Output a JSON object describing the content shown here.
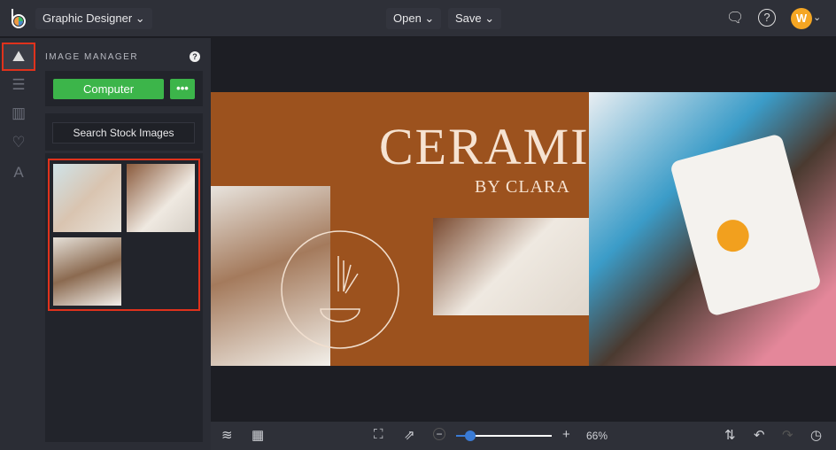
{
  "header": {
    "app_menu": "Graphic Designer",
    "open": "Open",
    "save": "Save",
    "avatar_initial": "W"
  },
  "rail": {
    "items": [
      "image-manager",
      "adjust",
      "layout",
      "favorites",
      "text"
    ]
  },
  "panel": {
    "title": "IMAGE MANAGER",
    "help": "?",
    "computer": "Computer",
    "more": "•••",
    "search_stock": "Search Stock Images",
    "thumbnail_count": 3
  },
  "canvas": {
    "title": "CERAMICS",
    "subtitle": "BY CLARA"
  },
  "bottom": {
    "zoom_label": "66%",
    "zoom_value": 66
  },
  "colors": {
    "accent": "#3cb54a",
    "highlight": "#e0321c",
    "canvas_bg": "#9c521e",
    "avatar": "#f5a623"
  }
}
